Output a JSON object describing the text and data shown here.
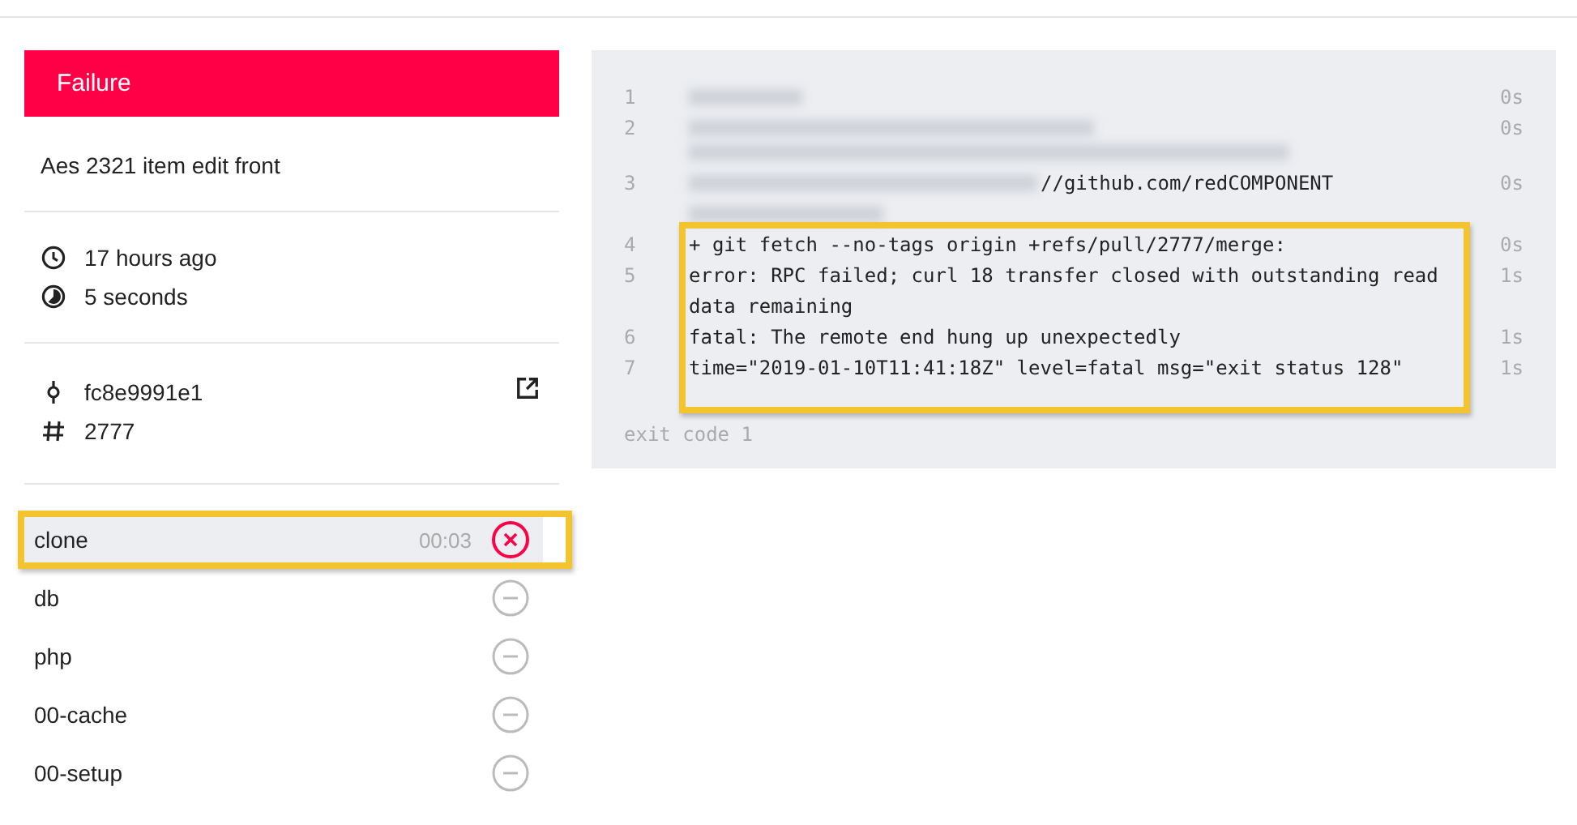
{
  "build": {
    "status": "Failure",
    "kind": "failure",
    "message": "Aes 2321 item edit front",
    "time_ago": "17 hours ago",
    "duration": "5 seconds",
    "commit": "fc8e9991e1",
    "pull_request": "2777"
  },
  "steps": [
    {
      "name": "clone",
      "duration": "00:03",
      "failed": true,
      "selected": true,
      "highlighted": true
    },
    {
      "name": "db",
      "failed": false,
      "selected": false,
      "highlighted": false
    },
    {
      "name": "php",
      "failed": false,
      "selected": false,
      "highlighted": false
    },
    {
      "name": "00-cache",
      "failed": false,
      "selected": false,
      "highlighted": false
    },
    {
      "name": "00-setup",
      "failed": false,
      "selected": false,
      "highlighted": false
    }
  ],
  "log": {
    "lines": [
      {
        "number": "1",
        "kind": "redacted",
        "duration": "0s",
        "highlighted": false
      },
      {
        "number": "2",
        "kind": "redacted_wrapped",
        "duration": "0s",
        "highlighted": false
      },
      {
        "number": "3",
        "kind": "partial",
        "text": "//github.com/redCOMPONENT",
        "duration": "0s",
        "highlighted": false
      },
      {
        "number": "4",
        "kind": "text",
        "text": "+ git fetch --no-tags origin +refs/pull/2777/merge:",
        "duration": "0s",
        "highlighted": true
      },
      {
        "number": "5",
        "kind": "text",
        "text": "error: RPC failed; curl 18 transfer closed with outstanding read data remaining",
        "duration": "1s",
        "highlighted": true
      },
      {
        "number": "6",
        "kind": "text",
        "text": "fatal: The remote end hung up unexpectedly",
        "duration": "1s",
        "highlighted": true
      },
      {
        "number": "7",
        "kind": "text",
        "text": "time=\"2019-01-10T11:41:18Z\" level=fatal msg=\"exit status 128\"",
        "duration": "1s",
        "highlighted": true
      }
    ],
    "exit_code": "exit code 1"
  }
}
